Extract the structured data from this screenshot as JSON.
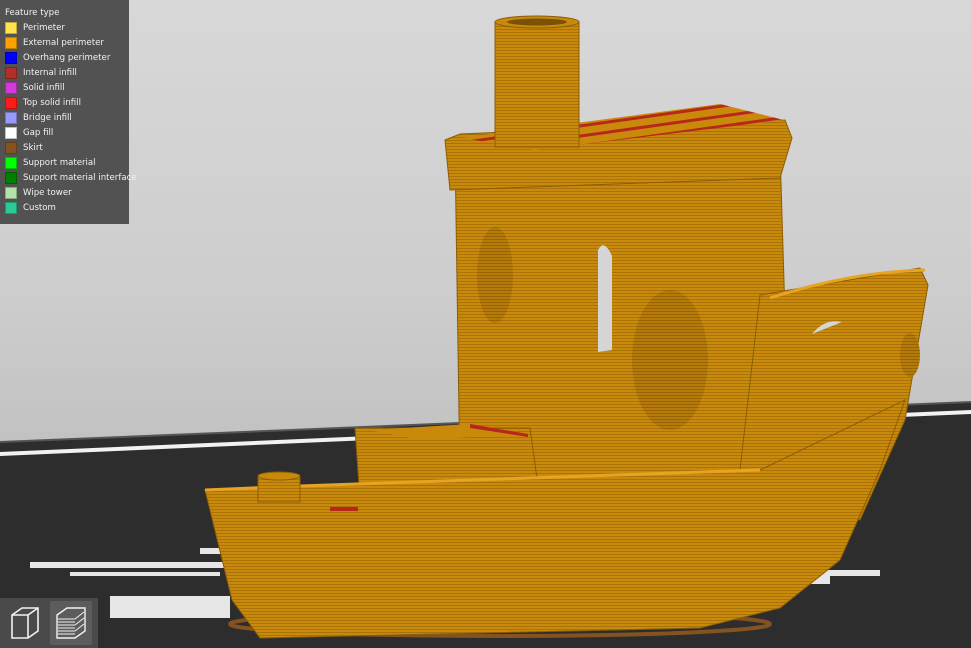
{
  "legend": {
    "title": "Feature type",
    "items": [
      {
        "label": "Perimeter",
        "color": "#ffe44c"
      },
      {
        "label": "External perimeter",
        "color": "#ffa200"
      },
      {
        "label": "Overhang perimeter",
        "color": "#0000ff"
      },
      {
        "label": "Internal infill",
        "color": "#b03029"
      },
      {
        "label": "Solid infill",
        "color": "#d23ad9"
      },
      {
        "label": "Top solid infill",
        "color": "#ff1a1a"
      },
      {
        "label": "Bridge infill",
        "color": "#9999ff"
      },
      {
        "label": "Gap fill",
        "color": "#ffffff"
      },
      {
        "label": "Skirt",
        "color": "#845321"
      },
      {
        "label": "Support material",
        "color": "#00ff00"
      },
      {
        "label": "Support material interface",
        "color": "#008000"
      },
      {
        "label": "Wipe tower",
        "color": "#b3e3ab"
      },
      {
        "label": "Custom",
        "color": "#28cc94"
      }
    ]
  },
  "viewport": {
    "model_color": "#c98a0c",
    "view_buttons": [
      {
        "name": "3d-view",
        "active": false
      },
      {
        "name": "layers-preview",
        "active": true
      }
    ]
  }
}
